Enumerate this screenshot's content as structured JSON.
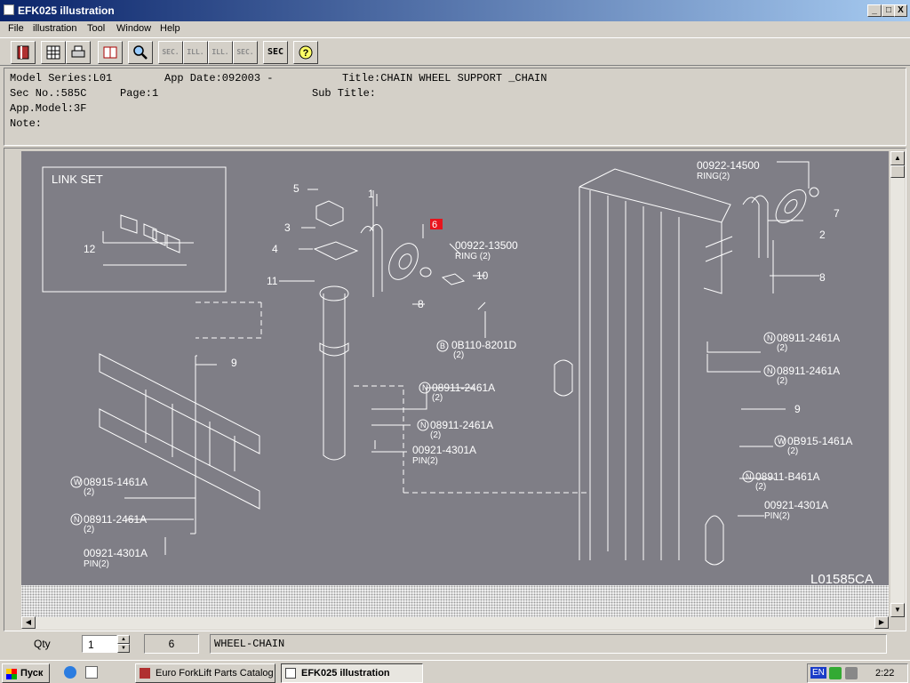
{
  "window": {
    "title": "EFK025 illustration",
    "controls": [
      "_",
      "□",
      "X"
    ]
  },
  "menu": [
    "File",
    "illustration",
    "Tool",
    "Window",
    "Help"
  ],
  "toolbar": {
    "sec_label": "SEC.",
    "ill_label": "ILL.",
    "sec_q_label": "SEC"
  },
  "info": {
    "model_series": "Model Series:L01",
    "app_date": "App Date:092003 -",
    "title": "Title:CHAIN WHEEL SUPPORT _CHAIN",
    "sec_no": "Sec No.:585C",
    "page": "Page:1",
    "sub_title": "Sub Title:",
    "app_model": "App.Model:3F",
    "note": "Note:"
  },
  "drawing": {
    "link_set": "LINK SET",
    "drawing_id": "L01585CA",
    "callouts": {
      "c1": "1",
      "c2": "2",
      "c3": "3",
      "c4": "4",
      "c5": "5",
      "c6": "6",
      "c7": "7",
      "c8a": "8",
      "c8b": "8",
      "c9a": "9",
      "c9b": "9",
      "c10": "10",
      "c11": "11",
      "c12": "12"
    },
    "parts": {
      "ring13500": "00922-13500",
      "ring13500_sub": "RING (2)",
      "ring14500": "00922-14500",
      "ring14500_sub": "RING(2)",
      "b8201": "0B110-8201D",
      "b8201_sub": "(2)",
      "n2461_mid1": "08911-2461A",
      "n2461_mid1_sub": "(2)",
      "n2461_mid2": "08911-2461A",
      "n2461_mid2_sub": "(2)",
      "pin_mid": "00921-4301A",
      "pin_mid_sub": "PIN(2)",
      "w1461_left": "08915-1461A",
      "w1461_left_sub": "(2)",
      "n2461_left": "08911-2461A",
      "n2461_left_sub": "(2)",
      "pin_left": "00921-4301A",
      "pin_left_sub": "PIN(2)",
      "n2461_r1": "08911-2461A",
      "n2461_r1_sub": "(2)",
      "n2461_r2": "08911-2461A",
      "n2461_r2_sub": "(2)",
      "w1461_right": "0B915-1461A",
      "w1461_right_sub": "(2)",
      "n8461_right": "08911-B461A",
      "n8461_right_sub": "(2)",
      "pin_right": "00921-4301A",
      "pin_right_sub": "PIN(2)"
    },
    "markers": {
      "n": "N",
      "w": "W",
      "b": "B"
    }
  },
  "bottom": {
    "qty_label": "Qty",
    "qty_value": "1",
    "part_no": "6",
    "part_name": "WHEEL-CHAIN"
  },
  "taskbar": {
    "start_label": "Пуск",
    "tasks": [
      "Euro ForkLift Parts Catalog",
      "EFK025 illustration"
    ],
    "lang": "EN",
    "clock": "2:22"
  },
  "colors": {
    "drawing_bg": "#7f7e86",
    "line": "#ffffff",
    "highlight": "#e8141c",
    "titlebar": "#0a246a"
  }
}
